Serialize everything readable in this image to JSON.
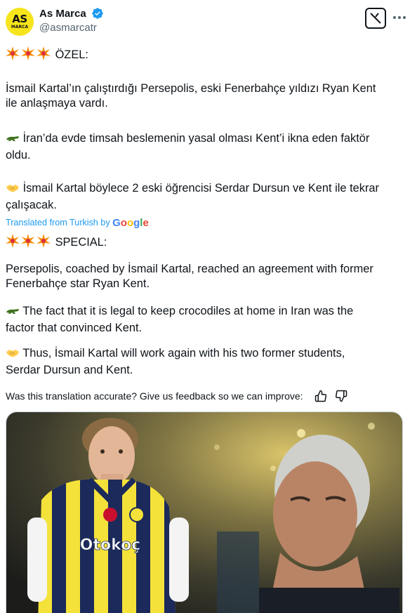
{
  "author": {
    "display_name": "As Marca",
    "handle": "@asmarcatr",
    "avatar_text_top": "AS",
    "avatar_text_bottom": "MARCA",
    "verified_color": "#1d9bf0"
  },
  "original_text": {
    "line1": "ÖZEL:",
    "para1_a": "İsmail Kartal’ın çalıştırdığı Persepolis, eski Fenerbahçe yıldızı Ryan Kent",
    "para1_b": "ile anlaşmaya vardı.",
    "para2_a": "İran’da evde timsah beslemenin yasal olması Kent’i ikna eden faktör",
    "para2_b": "oldu.",
    "para3_a": "İsmail Kartal böylece 2 eski öğrencisi Serdar Dursun ve Kent ile tekrar",
    "para3_b": "çalışacak."
  },
  "translation_label": "Translated from Turkish by",
  "google_letters": [
    "G",
    "o",
    "o",
    "g",
    "l",
    "e"
  ],
  "translated_text": {
    "line1": "SPECIAL:",
    "para1_a": "Persepolis, coached by İsmail Kartal, reached an agreement with former",
    "para1_b": "Fenerbahçe star Ryan Kent.",
    "para2_a": "The fact that it is legal to keep crocodiles at home in Iran was the",
    "para2_b": "factor that convinced Kent.",
    "para3_a": "Thus, İsmail Kartal will work again with his two former students,",
    "para3_b": "Serdar Dursun and Kent."
  },
  "feedback_prompt": "Was this translation accurate? Give us feedback so we can improve:",
  "media": {
    "shirt_sponsor": "Otokoç",
    "description_icon": "photo"
  },
  "icons": {
    "collision": "collision-emoji",
    "crocodile": "crocodile-emoji",
    "handshake": "handshake-emoji",
    "grok": "grok-icon",
    "more": "more-icon",
    "thumbs_up": "thumbs-up-icon",
    "thumbs_down": "thumbs-down-icon"
  }
}
